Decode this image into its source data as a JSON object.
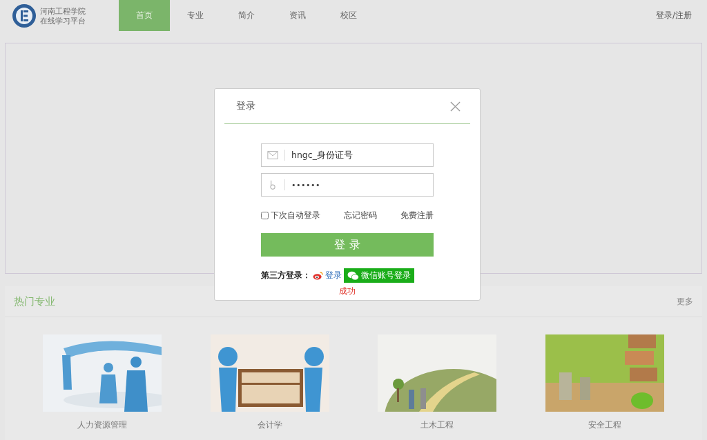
{
  "header": {
    "logo_lines": [
      "河南工程学院",
      "在线学习平台"
    ],
    "nav": [
      {
        "label": "首页",
        "selected": true
      },
      {
        "label": "专业",
        "selected": false
      },
      {
        "label": "简介",
        "selected": false
      },
      {
        "label": "资讯",
        "selected": false
      },
      {
        "label": "校区",
        "selected": false
      }
    ],
    "auth_link": "登录/注册"
  },
  "hot_majors": {
    "title": "热门专业",
    "more": "更多",
    "items": [
      {
        "caption": "人力资源管理",
        "kind": "picture"
      },
      {
        "caption": "会计学",
        "kind": "picture"
      },
      {
        "caption": "土木工程",
        "kind": "picture"
      },
      {
        "caption": "安全工程",
        "kind": "picture"
      }
    ]
  },
  "login_dialog": {
    "title": "登录",
    "username": "hngc_身份证号",
    "password": "••••••",
    "remember": {
      "label": "下次自动登录",
      "checked": false
    },
    "forgot": "忘记密码",
    "register": "免费注册",
    "submit": "登 录",
    "third_party_label": "第三方登录：",
    "weibo_login": "登录",
    "wechat_login": "微信账号登录",
    "status": "成功"
  }
}
